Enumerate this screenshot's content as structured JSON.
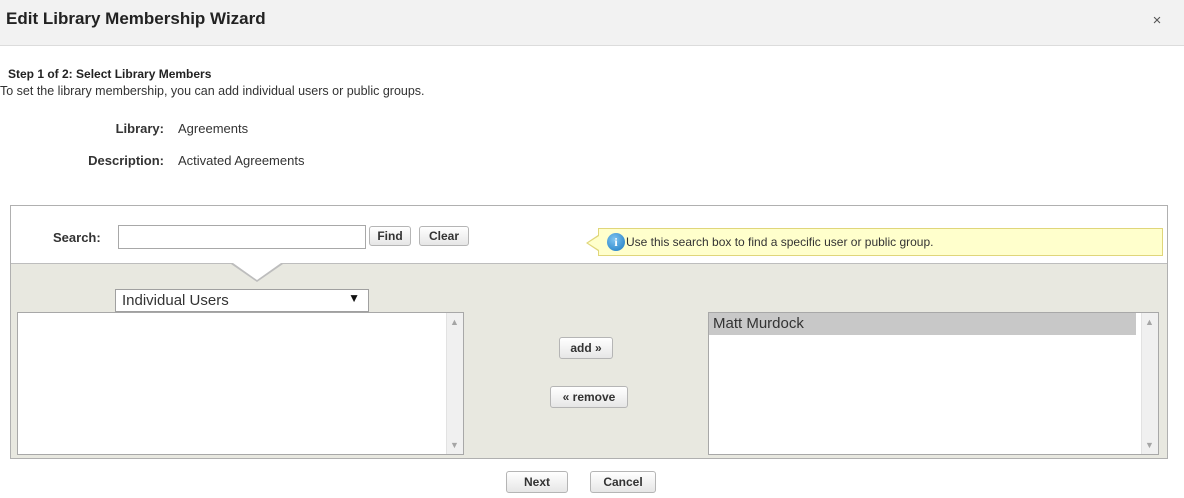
{
  "dialog": {
    "title": "Edit Library Membership Wizard",
    "close_glyph": "×"
  },
  "step": {
    "heading": "Step 1 of 2: Select Library Members",
    "instruction": "To set the library membership, you can add individual users or public groups."
  },
  "fields": {
    "library_label": "Library:",
    "library_value": "Agreements",
    "description_label": "Description:",
    "description_value": "Activated Agreements"
  },
  "search": {
    "label": "Search:",
    "value": "",
    "find_label": "Find",
    "clear_label": "Clear",
    "tip_icon_glyph": "i",
    "tip_text": "Use this search box to find a specific user or public group."
  },
  "filter": {
    "selected": "Individual Users",
    "arrow_glyph": "▼"
  },
  "available_list": {
    "items": []
  },
  "actions": {
    "add_label": "add »",
    "remove_label": "« remove"
  },
  "selected_list": {
    "items": [
      "Matt Murdock"
    ]
  },
  "footer": {
    "next_label": "Next",
    "cancel_label": "Cancel"
  },
  "icons": {
    "close": "close-icon",
    "info": "info-icon",
    "dropdown": "chevron-down-icon"
  },
  "colors": {
    "header_bg": "#f2f2f2",
    "panel_bg": "#e8e8e0",
    "tip_bg": "#ffffcc",
    "selected_item_bg": "#c8c8c8",
    "info_icon": "#1a78c2"
  }
}
